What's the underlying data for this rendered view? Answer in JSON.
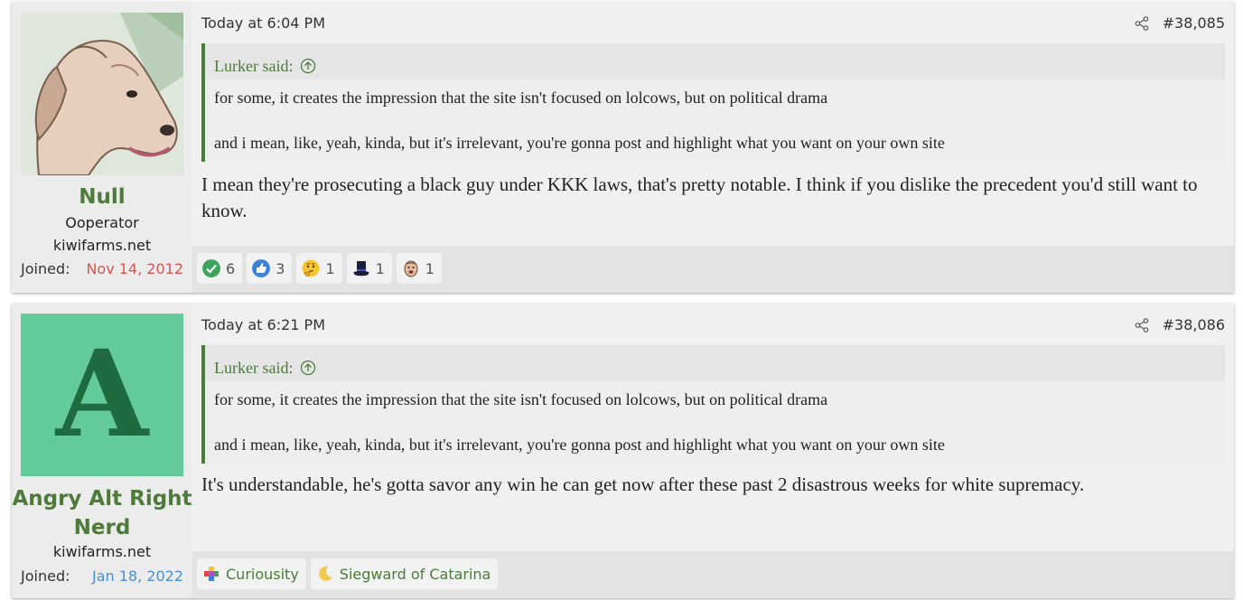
{
  "posts": [
    {
      "username": "Null",
      "user_title": "Ooperator",
      "user_site": "kiwifarms.net",
      "joined_label": "Joined:",
      "joined_date": "Nov 14, 2012",
      "date": "Today at 6:04 PM",
      "post_number": "#38,085",
      "quote": {
        "author": "Lurker said:",
        "lines": [
          "for some, it creates the impression that the site isn't focused on lolcows, but on political drama",
          "and i mean, like, yeah, kinda, but it's irrelevant, you're gonna post and highlight what you want on your own site"
        ]
      },
      "message": "I mean they're prosecuting a black guy under KKK laws, that's pretty notable. I think if you dislike the precedent you'd still want to know.",
      "reactions": [
        {
          "icon": "check-icon",
          "count": "6"
        },
        {
          "icon": "thumbs-up-icon",
          "count": "3"
        },
        {
          "icon": "thinking-face-icon",
          "count": "1"
        },
        {
          "icon": "top-hat-icon",
          "count": "1"
        },
        {
          "icon": "face-icon",
          "count": "1"
        }
      ]
    },
    {
      "username": "Angry Alt Right Nerd",
      "avatar_letter": "A",
      "user_site": "kiwifarms.net",
      "joined_label": "Joined:",
      "joined_date": "Jan 18, 2022",
      "date": "Today at 6:21 PM",
      "post_number": "#38,086",
      "quote": {
        "author": "Lurker said:",
        "lines": [
          "for some, it creates the impression that the site isn't focused on lolcows, but on political drama",
          "and i mean, like, yeah, kinda, but it's irrelevant, you're gonna post and highlight what you want on your own site"
        ]
      },
      "message": "It's understandable, he's gotta savor any win he can get now after these past 2 disastrous weeks for white supremacy.",
      "reactions": [
        {
          "icon": "puzzle-icon",
          "label": "Curiousity"
        },
        {
          "icon": "moon-icon",
          "label": "Siegward of Catarina"
        }
      ]
    }
  ],
  "colors": {
    "username": "#4c7b3a",
    "quote_border": "#4c7b3a",
    "avatar_bg": "#63cb99",
    "joined_date_1": "#d9534f",
    "joined_date_2": "#4a8fd1"
  }
}
